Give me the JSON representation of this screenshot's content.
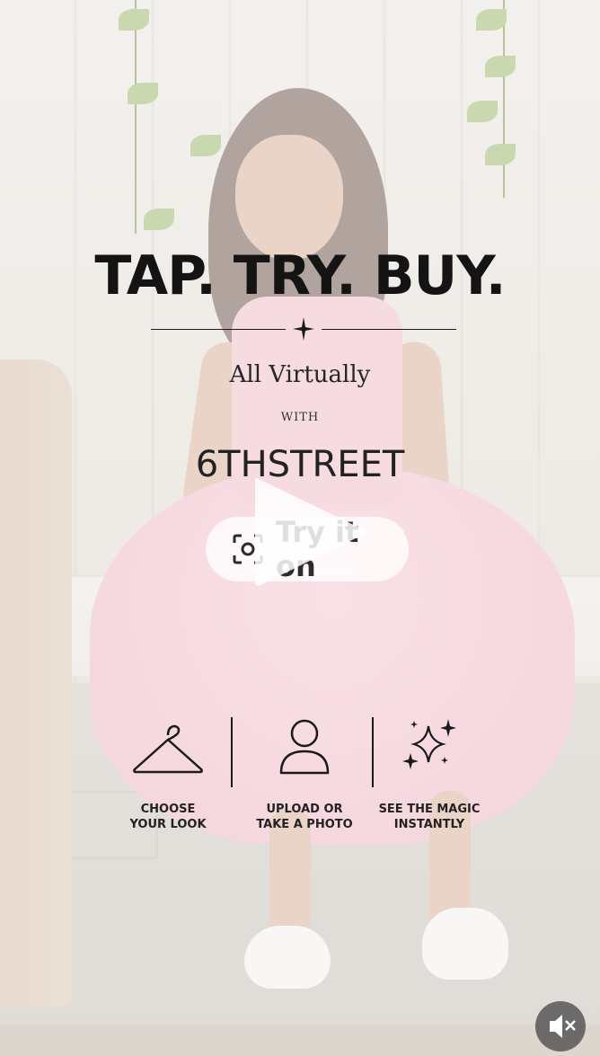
{
  "ad": {
    "headline": "TAP. TRY. BUY.",
    "subhead": "All Virtually",
    "with": "WITH",
    "brand": "6THSTREET",
    "try_button_label": "Try it on"
  },
  "steps": [
    {
      "icon": "hanger-icon",
      "caption": "CHOOSE\nYOUR LOOK"
    },
    {
      "icon": "person-icon",
      "caption": "UPLOAD OR\nTAKE A PHOTO"
    },
    {
      "icon": "sparkles-icon",
      "caption": "SEE THE MAGIC\nINSTANTLY"
    }
  ],
  "controls": {
    "play_icon": "play-icon",
    "mute_icon": "muted-speaker-icon"
  },
  "colors": {
    "text": "#141414",
    "button_bg": "#ffffff",
    "dress_pink": "#f2b4c5"
  }
}
